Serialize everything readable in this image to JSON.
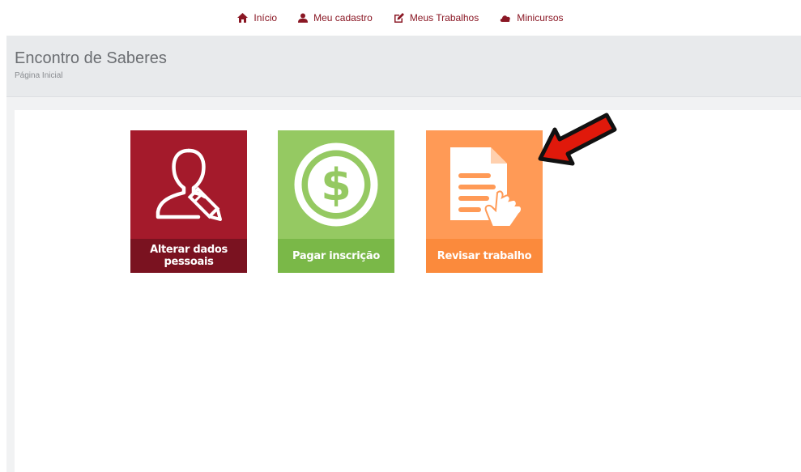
{
  "nav": {
    "items": [
      {
        "label": "Início",
        "icon": "home-icon"
      },
      {
        "label": "Meu cadastro",
        "icon": "user-icon"
      },
      {
        "label": "Meus Trabalhos",
        "icon": "edit-icon"
      },
      {
        "label": "Minicursos",
        "icon": "cloud-icon"
      }
    ]
  },
  "header": {
    "title": "Encontro de Saberes",
    "subtitle": "Página Inicial"
  },
  "tiles": [
    {
      "label": "Alterar dados pessoais",
      "icon": "user-edit-icon",
      "color": "#a41a2b"
    },
    {
      "label": "Pagar inscrição",
      "icon": "dollar-icon",
      "color": "#95c962"
    },
    {
      "label": "Revisar trabalho",
      "icon": "document-hand-icon",
      "color": "#ff9a56"
    }
  ],
  "colors": {
    "brand": "#8a1724",
    "arrow": "#e0190b"
  }
}
